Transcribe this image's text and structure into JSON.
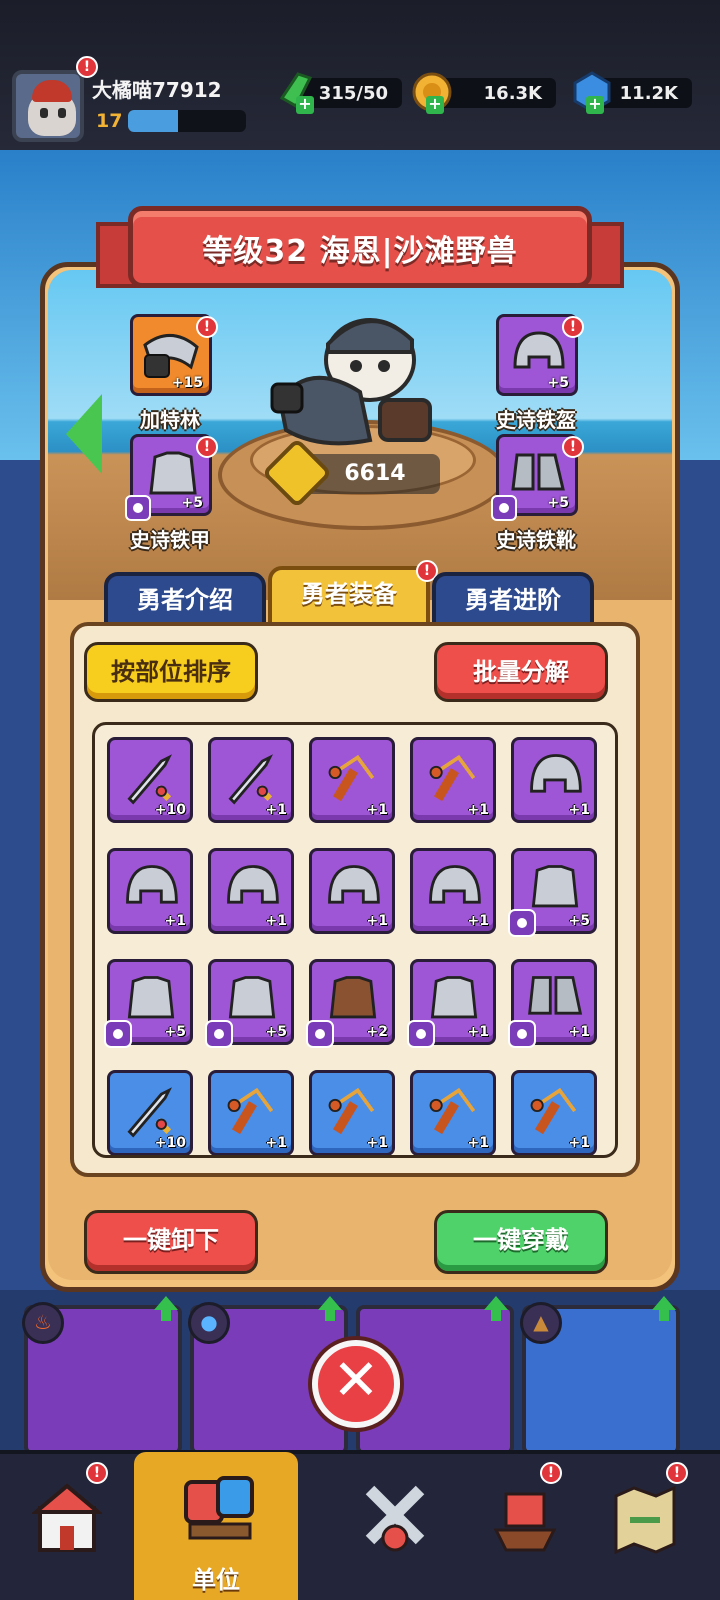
{
  "player": {
    "name": "大橘喵77912",
    "level": "17",
    "xp_fraction": 0.42
  },
  "resources": {
    "energy": "315/50",
    "coins": "16.3K",
    "gems": "11.2K"
  },
  "hero": {
    "title": "等级32 海恩|沙滩野兽",
    "power": "6614",
    "slots": [
      {
        "label": "加特林",
        "plus": "+15",
        "rarity": "orange",
        "icon": "gatling-icon"
      },
      {
        "label": "史诗铁盔",
        "plus": "+5",
        "rarity": "purple",
        "icon": "helmet-icon"
      },
      {
        "label": "史诗铁甲",
        "plus": "+5",
        "rarity": "purple",
        "icon": "armor-icon"
      },
      {
        "label": "史诗铁靴",
        "plus": "+5",
        "rarity": "purple",
        "icon": "boots-icon"
      }
    ]
  },
  "tabs": [
    "勇者介绍",
    "勇者装备",
    "勇者进阶"
  ],
  "buttons": {
    "sort": "按部位排序",
    "batch": "批量分解",
    "unequip": "一键卸下",
    "equip": "一键穿戴"
  },
  "inventory": [
    {
      "icon": "sword-icon",
      "plus": "+10",
      "rarity": "purple"
    },
    {
      "icon": "sword-icon",
      "plus": "+1",
      "rarity": "purple"
    },
    {
      "icon": "slingshot-icon",
      "plus": "+1",
      "rarity": "purple"
    },
    {
      "icon": "slingshot-icon",
      "plus": "+1",
      "rarity": "purple"
    },
    {
      "icon": "helmet-icon",
      "plus": "+1",
      "rarity": "purple"
    },
    {
      "icon": "helmet-icon",
      "plus": "+1",
      "rarity": "purple"
    },
    {
      "icon": "helmet-icon",
      "plus": "+1",
      "rarity": "purple"
    },
    {
      "icon": "helmet-icon",
      "plus": "+1",
      "rarity": "purple"
    },
    {
      "icon": "helmet-icon",
      "plus": "+1",
      "rarity": "purple"
    },
    {
      "icon": "armor-icon",
      "plus": "+5",
      "rarity": "purple",
      "badge": true
    },
    {
      "icon": "armor-icon",
      "plus": "+5",
      "rarity": "purple",
      "badge": true
    },
    {
      "icon": "armor-icon",
      "plus": "+5",
      "rarity": "purple",
      "badge": true
    },
    {
      "icon": "leather-armor-icon",
      "plus": "+2",
      "rarity": "purple",
      "badge": true
    },
    {
      "icon": "armor-icon",
      "plus": "+1",
      "rarity": "purple",
      "badge": true
    },
    {
      "icon": "boots-icon",
      "plus": "+1",
      "rarity": "purple",
      "badge": true
    },
    {
      "icon": "sword-icon",
      "plus": "+10",
      "rarity": "blue"
    },
    {
      "icon": "slingshot-icon",
      "plus": "+1",
      "rarity": "blue"
    },
    {
      "icon": "slingshot-icon",
      "plus": "+1",
      "rarity": "blue"
    },
    {
      "icon": "slingshot-icon",
      "plus": "+1",
      "rarity": "blue"
    },
    {
      "icon": "slingshot-icon",
      "plus": "+1",
      "rarity": "blue"
    }
  ],
  "nav": {
    "active_label": "单位"
  },
  "colors": {
    "purple": "#9e56d6",
    "blue": "#4a8ee8",
    "orange": "#f08a2c",
    "accent_yellow": "#f2c33a",
    "red": "#ef4f4a",
    "green": "#4fd26a"
  }
}
